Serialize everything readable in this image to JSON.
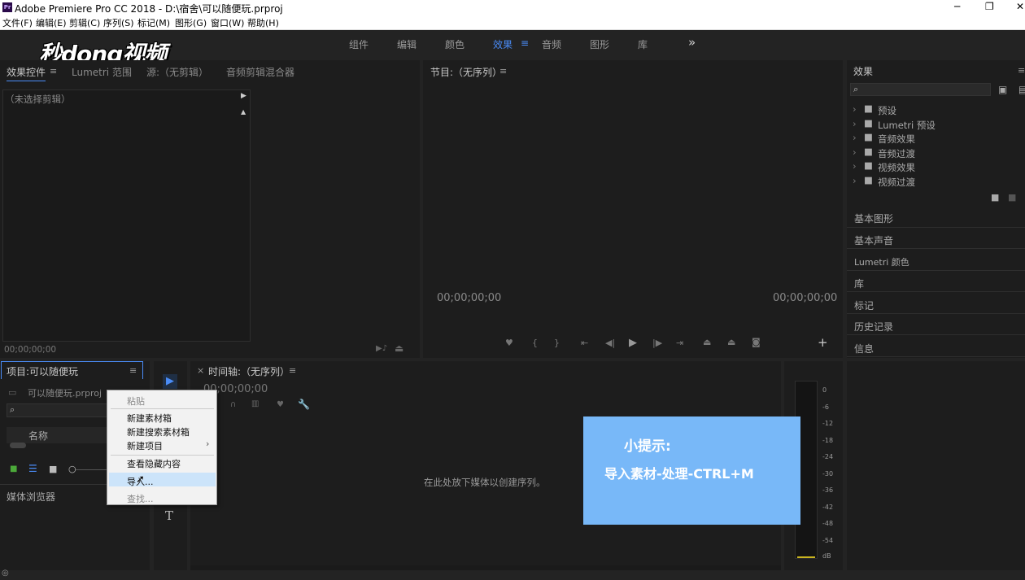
{
  "titlebar": {
    "title": "Adobe Premiere Pro CC 2018 - D:\\宿舍\\可以随便玩.prproj",
    "minimize": "─",
    "maximize": "❐",
    "close": "✕"
  },
  "menu": [
    "文件(F)",
    "编辑(E)",
    "剪辑(C)",
    "序列(S)",
    "标记(M)",
    "图形(G)",
    "窗口(W)",
    "帮助(H)"
  ],
  "watermark": "秒dong视频",
  "workspaces": {
    "items": [
      "组件",
      "编辑",
      "颜色",
      "效果",
      "音频",
      "图形",
      "库"
    ],
    "active": "效果",
    "more": "»",
    "menu": "≡"
  },
  "source_panel": {
    "tabs": [
      "效果控件",
      "Lumetri 范围",
      "源:（无剪辑）",
      "音频剪辑混合器"
    ],
    "no_clip": "（未选择剪辑）",
    "timecode": "00;00;00;00"
  },
  "program_panel": {
    "title": "节目:（无序列）",
    "timecode_left": "00;00;00;00",
    "timecode_right": "00;00;00;00"
  },
  "effects_panel": {
    "title": "效果",
    "tree": [
      "预设",
      "Lumetri 预设",
      "音频效果",
      "音频过渡",
      "视频效果",
      "视频过渡"
    ]
  },
  "right_sections": [
    "基本图形",
    "基本声音",
    "Lumetri 颜色",
    "库",
    "标记",
    "历史记录",
    "信息"
  ],
  "project_panel": {
    "title": "项目:可以随便玩",
    "file": "可以随便玩.prproj",
    "column_name": "名称",
    "media_browser": "媒体浏览器"
  },
  "timeline": {
    "close": "×",
    "title": "时间轴:（无序列）",
    "timecode": "00;00;00;00",
    "drop_hint": "在此处放下媒体以创建序列。"
  },
  "meter": {
    "labels": [
      "0",
      "-6",
      "-12",
      "-18",
      "-24",
      "-30",
      "-36",
      "-42",
      "-48",
      "-54",
      "dB"
    ]
  },
  "context_menu": {
    "items": [
      {
        "label": "粘贴",
        "enabled": false
      },
      {
        "label": "新建素材箱",
        "enabled": true
      },
      {
        "label": "新建搜索素材箱",
        "enabled": true
      },
      {
        "label": "新建项目",
        "enabled": true,
        "submenu": "›"
      },
      {
        "label": "查看隐藏内容",
        "enabled": true
      },
      {
        "label": "导入...",
        "enabled": true,
        "highlighted": true
      },
      {
        "label": "查找...",
        "enabled": false
      }
    ]
  },
  "tip": {
    "title": "小提示:",
    "body": "导入素材-处理-CTRL+M"
  },
  "colors": {
    "accent": "#4a8cf7",
    "tip_bg": "#78b8f8",
    "highlight": "#cce4fa"
  }
}
